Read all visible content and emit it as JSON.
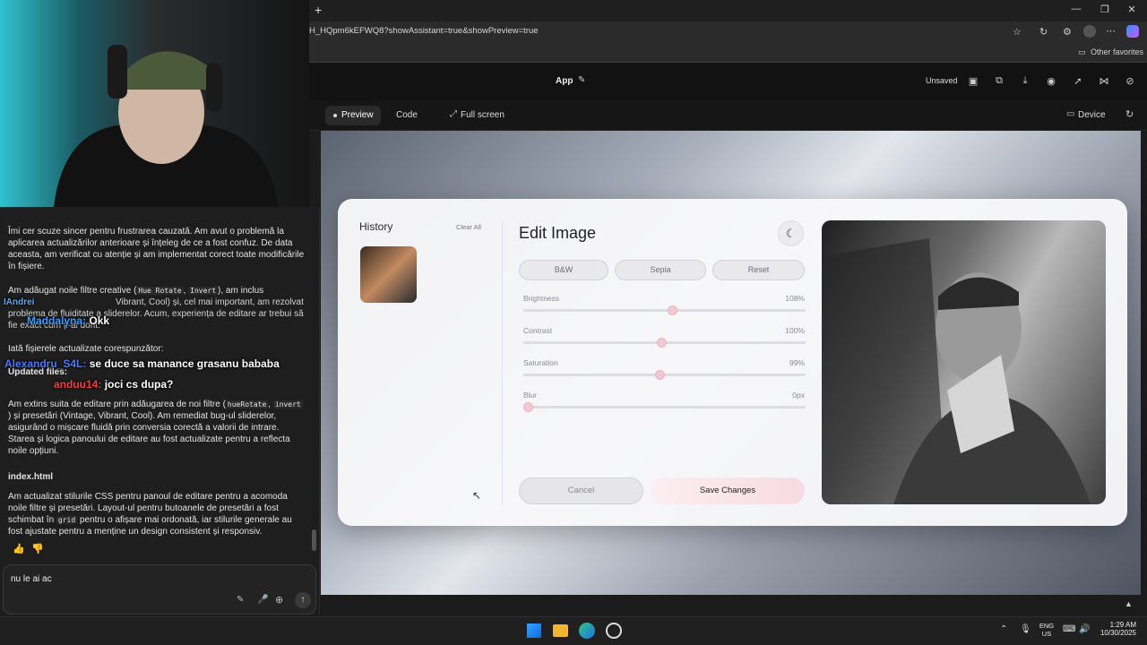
{
  "browser": {
    "url": "H_HQpm6kEFWQ8?showAssistant=true&showPreview=true",
    "favorites_label": "Other favorites"
  },
  "chat": {
    "paragraph1": "Îmi cer scuze sincer pentru frustrarea cauzată. Am avut o problemă la aplicarea actualizărilor anterioare și înțeleg de ce a fost confuz. De data aceasta, am verificat cu atenție și am implementat corect toate modificările în fișiere.",
    "paragraph2_a": "Am adăugat noile filtre creative (",
    "paragraph2_code1": "Hue Rotate",
    "paragraph2_code2": "Invert",
    "paragraph2_b": "), am inclus",
    "paragraph2_c": "Vibrant, Cool) și, cel mai important, am rezolvat problema de fluiditate a sliderelor. Acum, experiența de editare ar trebui să fie exact cum ți-ai dorit.",
    "files_intro": "Iată fișierele actualizate corespunzător:",
    "updated_files": "Updated files:",
    "paragraph3_a": "Am extins suita de editare prin adăugarea de noi filtre (",
    "paragraph3_code1": "hueRotate",
    "paragraph3_code2": "invert",
    "paragraph3_b": ") și presetări (Vintage, Vibrant, Cool). Am remediat bug-ul sliderelor, asigurând o mișcare fluidă prin conversia corectă a valorii de intrare. Starea și logica panoului de editare au fost actualizate pentru a reflecta noile opțiuni.",
    "file_name": "index.html",
    "paragraph4_a": "Am actualizat stilurile CSS pentru panoul de editare pentru a acomoda noile filtre și presetări. Layout-ul pentru butoanele de presetări a fost schimbat în",
    "paragraph4_code": "grid",
    "paragraph4_b": "pentru o afișare mai ordonată, iar stilurile generale au fost ajustate pentru a menține un design consistent și responsiv.",
    "input_value": "nu le ai ac"
  },
  "stream_overlay": {
    "user1": "Maddalyna:",
    "msg1": "Okk",
    "user2": "Alexandru_S4L:",
    "msg2": "se duce sa manance grasanu bababa",
    "user3": "anduu14:",
    "msg3": "joci cs dupa?",
    "user_partial": "IAndrei"
  },
  "app": {
    "title": "App",
    "unsaved": "Unsaved",
    "tabs": {
      "preview": "Preview",
      "code": "Code",
      "fullscreen": "Full screen"
    },
    "device": "Device"
  },
  "editor": {
    "history_title": "History",
    "clear_all": "Clear All",
    "title": "Edit Image",
    "presets": [
      "B&W",
      "Sepia",
      "Reset"
    ],
    "sliders": [
      {
        "label": "Brightness",
        "value": "108%",
        "fraction": 0.53
      },
      {
        "label": "Contrast",
        "value": "100%",
        "fraction": 0.49
      },
      {
        "label": "Saturation",
        "value": "99%",
        "fraction": 0.485
      },
      {
        "label": "Blur",
        "value": "0px",
        "fraction": 0.0
      }
    ],
    "cancel": "Cancel",
    "save": "Save Changes"
  },
  "taskbar": {
    "lang": "ENG",
    "region": "US",
    "time": "1:29 AM",
    "date": "10/30/2025"
  },
  "colors": {
    "accent_pink": "#f3c9d1",
    "card_bg": "#f8f8fa"
  }
}
